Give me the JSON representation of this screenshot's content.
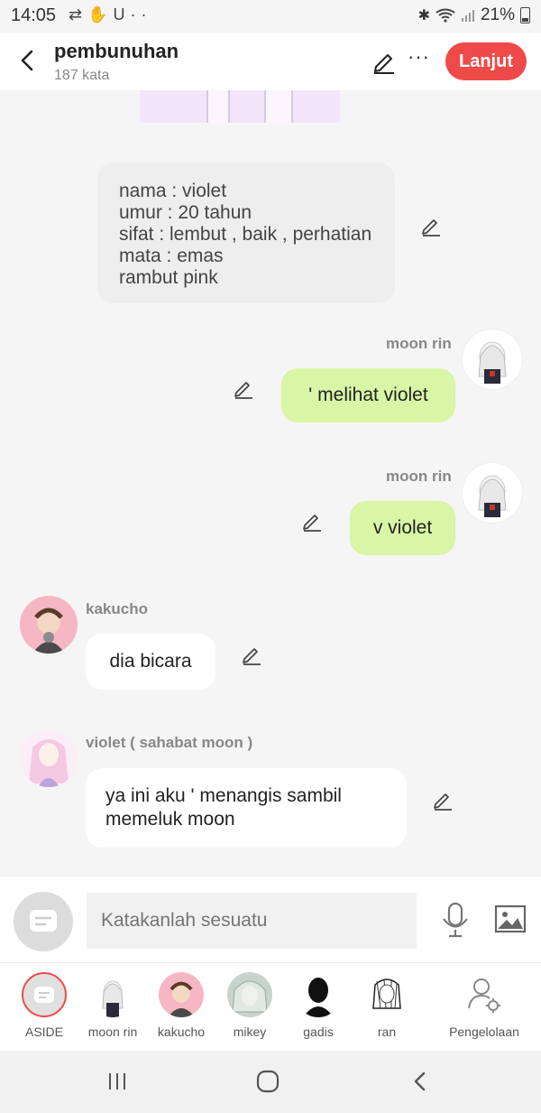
{
  "status_bar": {
    "time": "14:05",
    "left_icons": [
      "sync-icon",
      "hand-icon",
      "magnet-icon",
      "dots-icon"
    ],
    "battery": "21%",
    "right_icons": [
      "bluetooth-icon",
      "wifi-icon",
      "signal-icon",
      "battery-icon"
    ]
  },
  "header": {
    "title": "pembunuhan",
    "subtitle": "187 kata",
    "next_label": "Lanjut",
    "accent": "#ef4a4a"
  },
  "messages": [
    {
      "type": "narration",
      "lines": [
        "nama : violet",
        "umur : 20 tahun",
        "sifat : lembut , baik , perhatian",
        "mata : emas",
        "rambut pink"
      ]
    },
    {
      "type": "right",
      "name": "moon rin",
      "text": "' melihat violet",
      "color": "#d9f5a6"
    },
    {
      "type": "right",
      "name": "moon rin",
      "text": "v violet",
      "color": "#d9f5a6"
    },
    {
      "type": "left",
      "name": "kakucho",
      "text": "dia bicara"
    },
    {
      "type": "left",
      "name": "violet ( sahabat moon )",
      "text": "ya ini aku ' menangis sambil memeluk moon"
    }
  ],
  "input": {
    "placeholder": "Katakanlah sesuatu"
  },
  "characters": [
    {
      "label": "ASIDE"
    },
    {
      "label": "moon rin"
    },
    {
      "label": "kakucho"
    },
    {
      "label": "mikey"
    },
    {
      "label": "gadis"
    },
    {
      "label": "ran"
    },
    {
      "label": "Pengelolaan"
    }
  ]
}
